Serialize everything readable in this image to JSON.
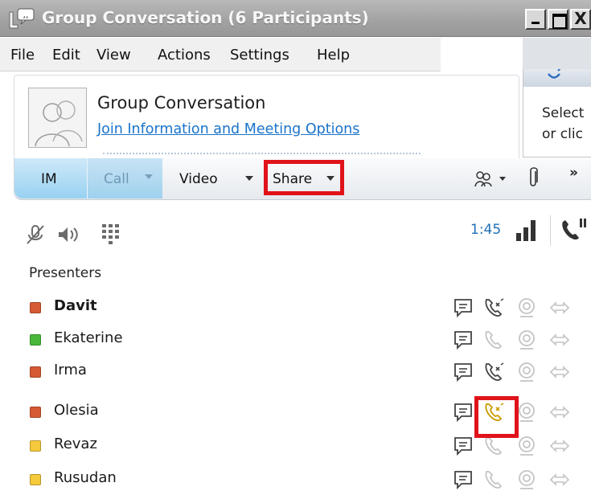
{
  "window": {
    "title": "Group Conversation (6 Participants)",
    "buttons": {
      "minimize": "_",
      "maximize": "□",
      "close": "X"
    }
  },
  "menu": [
    {
      "label": "File"
    },
    {
      "label": "Edit"
    },
    {
      "label": "View"
    },
    {
      "label": "Actions"
    },
    {
      "label": "Settings"
    },
    {
      "label": "Help"
    }
  ],
  "header": {
    "title": "Group Conversation",
    "link": "Join Information and Meeting Options"
  },
  "side_panel": {
    "line1": "Select",
    "line2": "or clic"
  },
  "toolbar": {
    "im": "IM",
    "call": "Call",
    "video": "Video",
    "share": "Share",
    "more": "»"
  },
  "audio": {
    "timer": "1:45"
  },
  "presenters": {
    "heading": "Presenters",
    "participants": [
      {
        "name": "Davit",
        "status_color": "#d65b34",
        "bold": true,
        "call_active": true,
        "call_ringing": false
      },
      {
        "name": "Ekaterine",
        "status_color": "#49b83a",
        "bold": false,
        "call_active": false,
        "call_ringing": false
      },
      {
        "name": "Irma",
        "status_color": "#d65b34",
        "bold": false,
        "call_active": true,
        "call_ringing": false
      },
      {
        "name": "Olesia",
        "status_color": "#d65b34",
        "bold": false,
        "call_active": true,
        "call_ringing": true
      },
      {
        "name": "Revaz",
        "status_color": "#f5c93c",
        "bold": false,
        "call_active": false,
        "call_ringing": false
      },
      {
        "name": "Rusudan",
        "status_color": "#f5c93c",
        "bold": false,
        "call_active": false,
        "call_ringing": false
      }
    ]
  },
  "colors": {
    "highlight": "#e0131a",
    "link": "#1a73c9",
    "im_tab": "#98d1f1",
    "ringing": "#c89a00"
  },
  "icons": {
    "title": "lync-conversation-icon",
    "mic": "microphone-muted-icon",
    "speaker": "speaker-icon",
    "dialpad": "dialpad-icon",
    "signal": "signal-bars-icon",
    "hangup": "end-call-icon",
    "people": "participants-icon",
    "attach": "paperclip-icon"
  }
}
